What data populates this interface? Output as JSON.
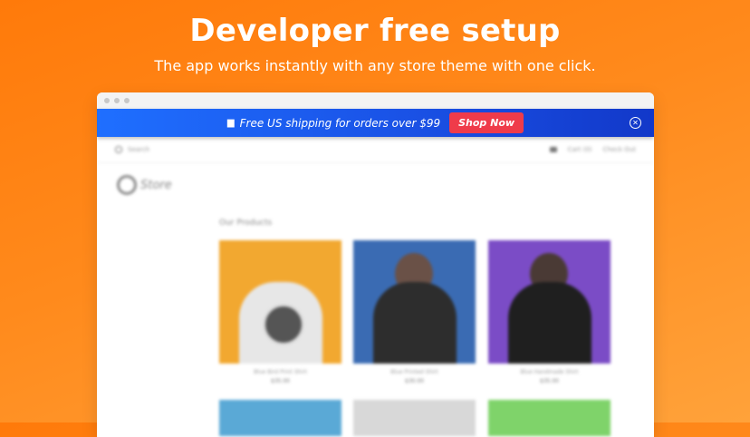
{
  "hero": {
    "title": "Developer free setup",
    "subtitle": "The app works instantly with any store theme with one click."
  },
  "announcement": {
    "flag_icon": "flag-us-icon",
    "text": "Free US shipping for orders over $99",
    "button_label": "Shop Now",
    "close_icon": "close-icon",
    "background": "#1f6fff",
    "button_color": "#ef3b4a"
  },
  "store": {
    "search_placeholder": "Search",
    "nav_right": [
      "Cart (0)",
      "Check Out"
    ],
    "logo_text": "Store",
    "section_title": "Our Products",
    "products": [
      {
        "name": "Blue Bird Print Shirt",
        "price": "$35.00"
      },
      {
        "name": "Blue Printed Shirt",
        "price": "$30.00"
      },
      {
        "name": "Blue Handmade Shirt",
        "price": "$35.00"
      }
    ]
  },
  "colors": {
    "background_start": "#ff7a0a",
    "background_end": "#ffa23a"
  }
}
